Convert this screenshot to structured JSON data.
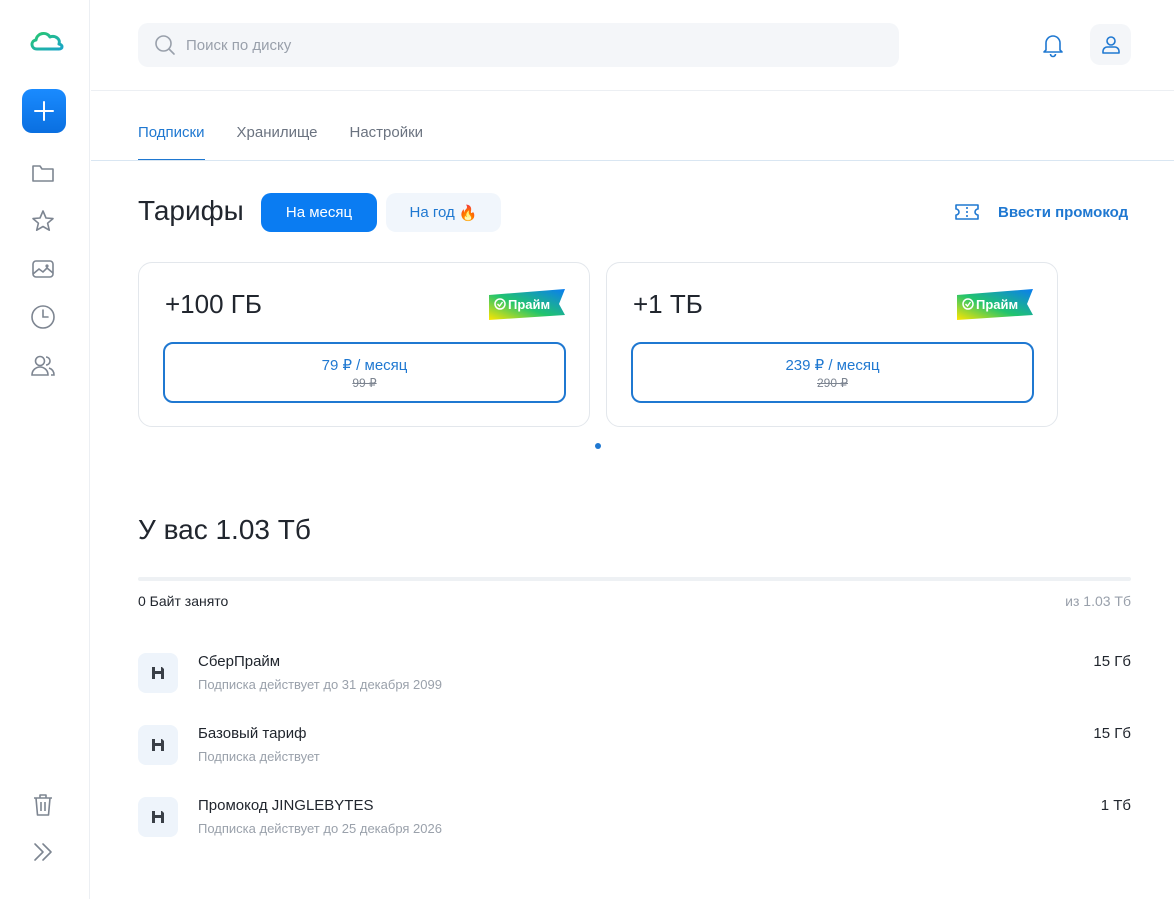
{
  "search": {
    "placeholder": "Поиск по диску"
  },
  "sidebar": {
    "items": [
      {
        "icon": "folder-icon"
      },
      {
        "icon": "star-icon"
      },
      {
        "icon": "gallery-icon"
      },
      {
        "icon": "clock-icon"
      },
      {
        "icon": "shared-users-icon"
      }
    ],
    "bottom": [
      {
        "icon": "trash-icon"
      },
      {
        "icon": "expand-icon"
      }
    ]
  },
  "tabs": [
    {
      "label": "Подписки",
      "active": true
    },
    {
      "label": "Хранилище",
      "active": false
    },
    {
      "label": "Настройки",
      "active": false
    }
  ],
  "tariffs": {
    "title": "Тарифы",
    "period_month": "На месяц",
    "period_year": "На год",
    "period_year_emoji": "🔥",
    "promo_label": "Ввести промокод",
    "plans": [
      {
        "size": "+100 ГБ",
        "badge": "Прайм",
        "price": "79 ₽ / месяц",
        "old_price": "99 ₽"
      },
      {
        "size": "+1 ТБ",
        "badge": "Прайм",
        "price": "239 ₽ / месяц",
        "old_price": "290 ₽"
      }
    ]
  },
  "storage": {
    "title": "У вас 1.03 Тб",
    "used": "0 Байт занято",
    "total": "из 1.03 Тб",
    "used_fraction": 0,
    "subscriptions": [
      {
        "name": "СберПрайм",
        "desc": "Подписка действует до 31 декабря 2099",
        "size": "15 Гб"
      },
      {
        "name": "Базовый тариф",
        "desc": "Подписка действует",
        "size": "15 Гб"
      },
      {
        "name": "Промокод JINGLEBYTES",
        "desc": "Подписка действует до 25 декабря 2026",
        "size": "1 Тб"
      }
    ]
  },
  "colors": {
    "accent": "#1f78d1",
    "primary_button": "#0a7cf2",
    "logo_green": "#21c46e"
  }
}
